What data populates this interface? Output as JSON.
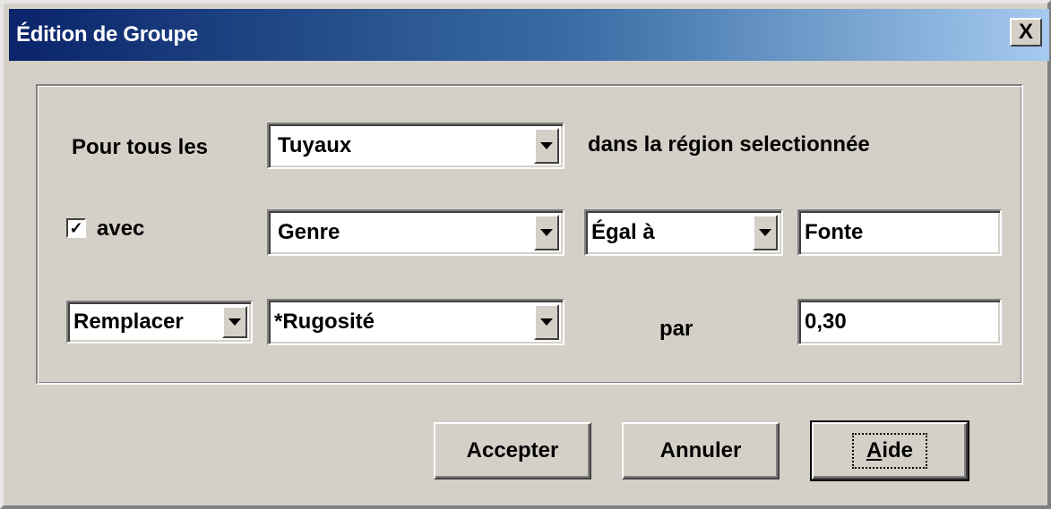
{
  "window": {
    "title": "Édition de Groupe",
    "close_label": "X"
  },
  "row1": {
    "label_prefix": "Pour tous les",
    "object_type": "Tuyaux",
    "label_suffix": "dans la  région selectionnée"
  },
  "row2": {
    "condition_checked": true,
    "checkbox_mark": "✓",
    "label": "avec",
    "property": "Genre",
    "operator": "Égal à",
    "value": "Fonte"
  },
  "row3": {
    "action": "Remplacer",
    "property": "*Rugosité",
    "label": "par",
    "value": "0,30"
  },
  "buttons": {
    "accept": "Accepter",
    "cancel": "Annuler",
    "help_accel": "A",
    "help_rest": "ide"
  },
  "icons": {
    "dropdown": "chevron-down-icon",
    "close": "close-icon",
    "check": "checkmark-icon"
  },
  "colors": {
    "titlebar_start": "#0a246a",
    "titlebar_end": "#a6caf0",
    "face": "#d4d0c8"
  }
}
